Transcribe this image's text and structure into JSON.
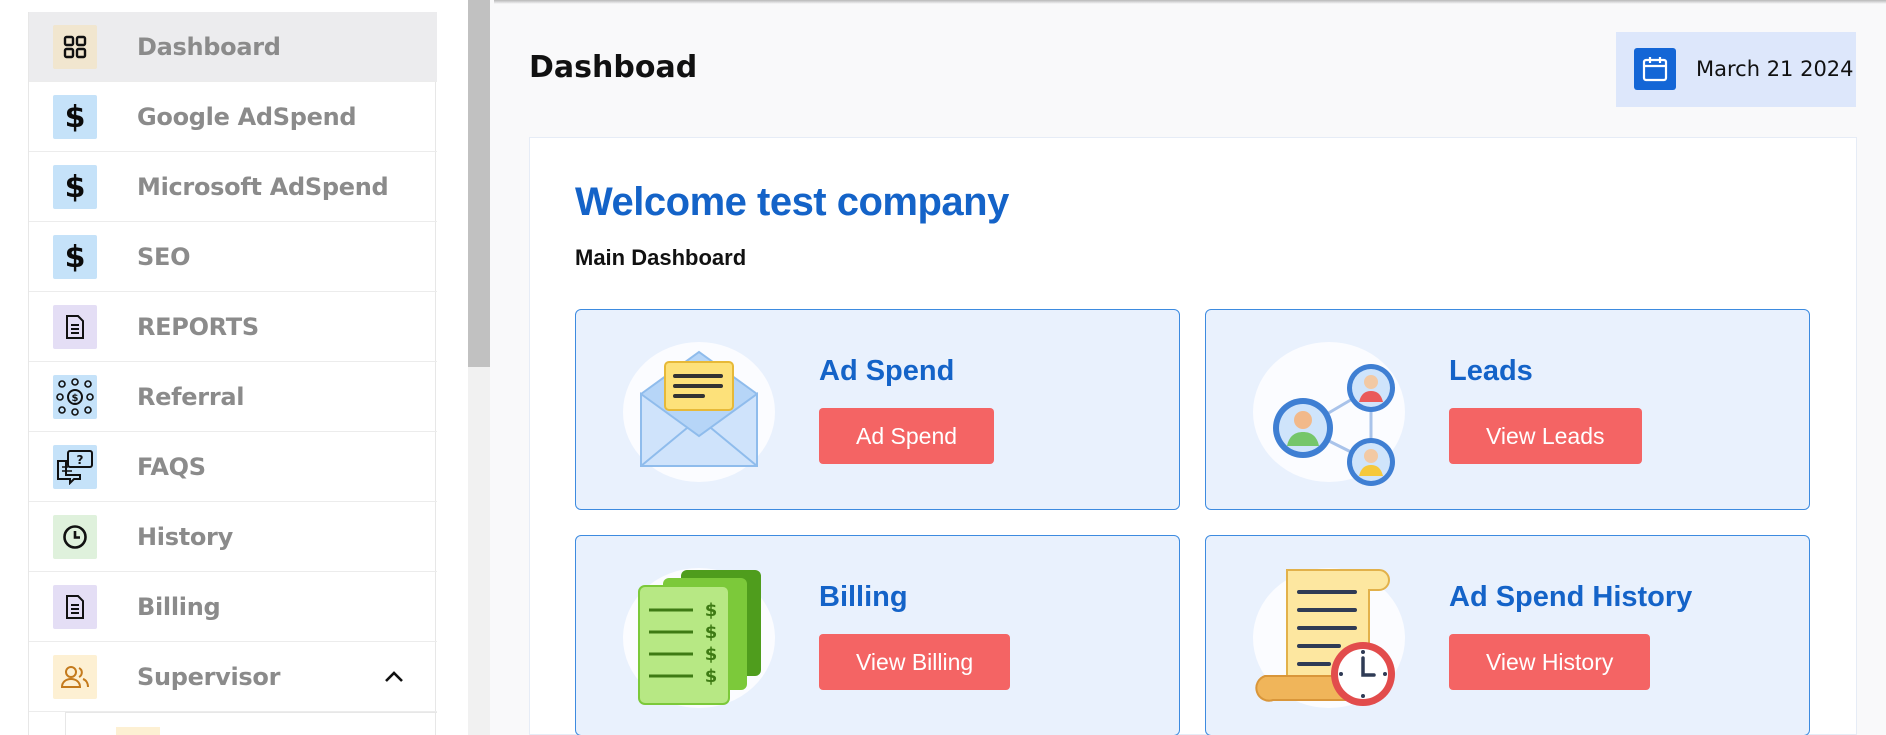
{
  "sidebar": {
    "items": [
      {
        "label": "Dashboard",
        "icon": "grid-icon",
        "icon_bg": "#f1e6cf"
      },
      {
        "label": "Google AdSpend",
        "icon": "dollar-icon",
        "icon_bg": "#c5e2f9"
      },
      {
        "label": "Microsoft AdSpend",
        "icon": "dollar-icon",
        "icon_bg": "#c5e2f9"
      },
      {
        "label": "SEO",
        "icon": "dollar-icon",
        "icon_bg": "#c5e2f9"
      },
      {
        "label": "REPORTS",
        "icon": "document-icon",
        "icon_bg": "#e4def5"
      },
      {
        "label": "Referral",
        "icon": "network-icon",
        "icon_bg": "#c5e2f9"
      },
      {
        "label": "FAQS",
        "icon": "chat-question-icon",
        "icon_bg": "#c5e2f9"
      },
      {
        "label": "History",
        "icon": "clock-icon",
        "icon_bg": "#dff1dc"
      },
      {
        "label": "Billing",
        "icon": "document-icon",
        "icon_bg": "#e4def5"
      },
      {
        "label": "Supervisor",
        "icon": "users-icon",
        "icon_bg": "#fdf0d3"
      }
    ],
    "dollar_symbol": "$"
  },
  "header": {
    "title": "Dashboad",
    "date": "March 21 2024"
  },
  "main": {
    "welcome": "Welcome test company",
    "subtitle": "Main Dashboard",
    "cards": [
      {
        "title": "Ad Spend",
        "button": "Ad Spend",
        "icon": "envelope-icon"
      },
      {
        "title": "Leads",
        "button": "View Leads",
        "icon": "people-network-icon"
      },
      {
        "title": "Billing",
        "button": "View Billing",
        "icon": "money-stack-icon"
      },
      {
        "title": "Ad Spend History",
        "button": "View History",
        "icon": "scroll-clock-icon"
      }
    ]
  },
  "colors": {
    "accent": "#1463c8",
    "button": "#f46464",
    "card_bg": "#e9f1fd",
    "card_border": "#3d8be0",
    "calendar": "#1466d6"
  }
}
